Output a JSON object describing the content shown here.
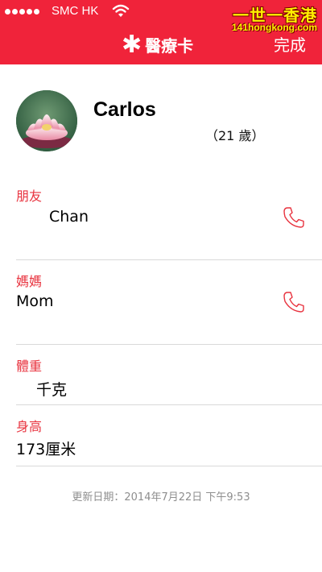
{
  "status_bar": {
    "carrier": "SMC HK",
    "signal_icon": "signal-dots-icon",
    "wifi_icon": "wifi-icon"
  },
  "watermark": {
    "chinese": "一世一香港",
    "latin": "141hongkong.com"
  },
  "nav": {
    "title": "醫療卡",
    "title_icon": "star-of-life-icon",
    "done_label": "完成"
  },
  "profile": {
    "name": "Carlos",
    "age": "（21 歲）",
    "avatar_icon": "lotus-photo"
  },
  "contacts": [
    {
      "relation": "朋友",
      "name": "Chan",
      "call_icon": "phone-icon"
    },
    {
      "relation": "媽媽",
      "name": "Mom",
      "call_icon": "phone-icon"
    }
  ],
  "fields": {
    "weight": {
      "label": "體重",
      "value": "千克"
    },
    "height": {
      "label": "身高",
      "value": "173厘米"
    }
  },
  "footer": {
    "updated": "更新日期：2014年7月22日 下午9:53"
  },
  "colors": {
    "accent": "#f0233a",
    "label": "#e8333f",
    "divider": "#d9d9d9"
  }
}
